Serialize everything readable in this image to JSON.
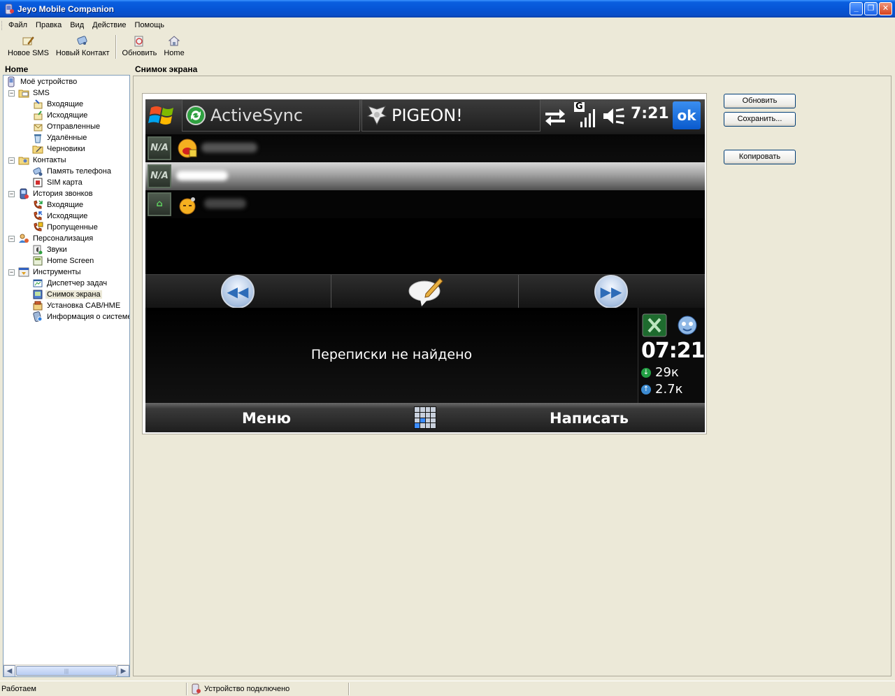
{
  "window": {
    "title": "Jeyo Mobile Companion"
  },
  "menu": [
    "Файл",
    "Правка",
    "Вид",
    "Действие",
    "Помощь"
  ],
  "toolbar": {
    "new_sms": "Новое SMS",
    "new_contact": "Новый Контакт",
    "refresh": "Обновить",
    "home": "Home"
  },
  "left_panel": {
    "title": "Home"
  },
  "tree": {
    "my_device": "Моё устройство",
    "sms": "SMS",
    "sms_inbox": "Входящие",
    "sms_outbox": "Исходящие",
    "sms_sent": "Отправленные",
    "sms_deleted": "Удалённые",
    "sms_drafts": "Черновики",
    "contacts": "Контакты",
    "phone_memory": "Память телефона",
    "sim_card": "SIM карта",
    "call_history": "История звонков",
    "calls_incoming": "Входящие",
    "calls_outgoing": "Исходящие",
    "calls_missed": "Пропущенные",
    "personalization": "Персонализация",
    "sounds": "Звуки",
    "home_screen": "Home Screen",
    "tools": "Инструменты",
    "task_manager": "Диспетчер задач",
    "screenshot": "Снимок экрана",
    "cab_install": "Установка CAB/HME",
    "system_info": "Информация о системе"
  },
  "main": {
    "title": "Снимок экрана",
    "buttons": {
      "refresh": "Обновить",
      "save": "Сохранить...",
      "copy": "Копировать"
    }
  },
  "phone": {
    "tab1": "ActiveSync",
    "tab2": "PIGEON!",
    "time": "7:21",
    "ok": "ok",
    "na1": "N/A",
    "na2": "N/A",
    "no_conversation": "Переписки не найдено",
    "big_time": "07:21",
    "down": "29к",
    "up": "2.7к",
    "soft_left": "Меню",
    "soft_right": "Написать",
    "network": "G"
  },
  "status": {
    "left": "Работаем",
    "device": "Устройство подключено"
  },
  "colors": {
    "titlebar": "#0655d6",
    "accent": "#316ac5"
  }
}
